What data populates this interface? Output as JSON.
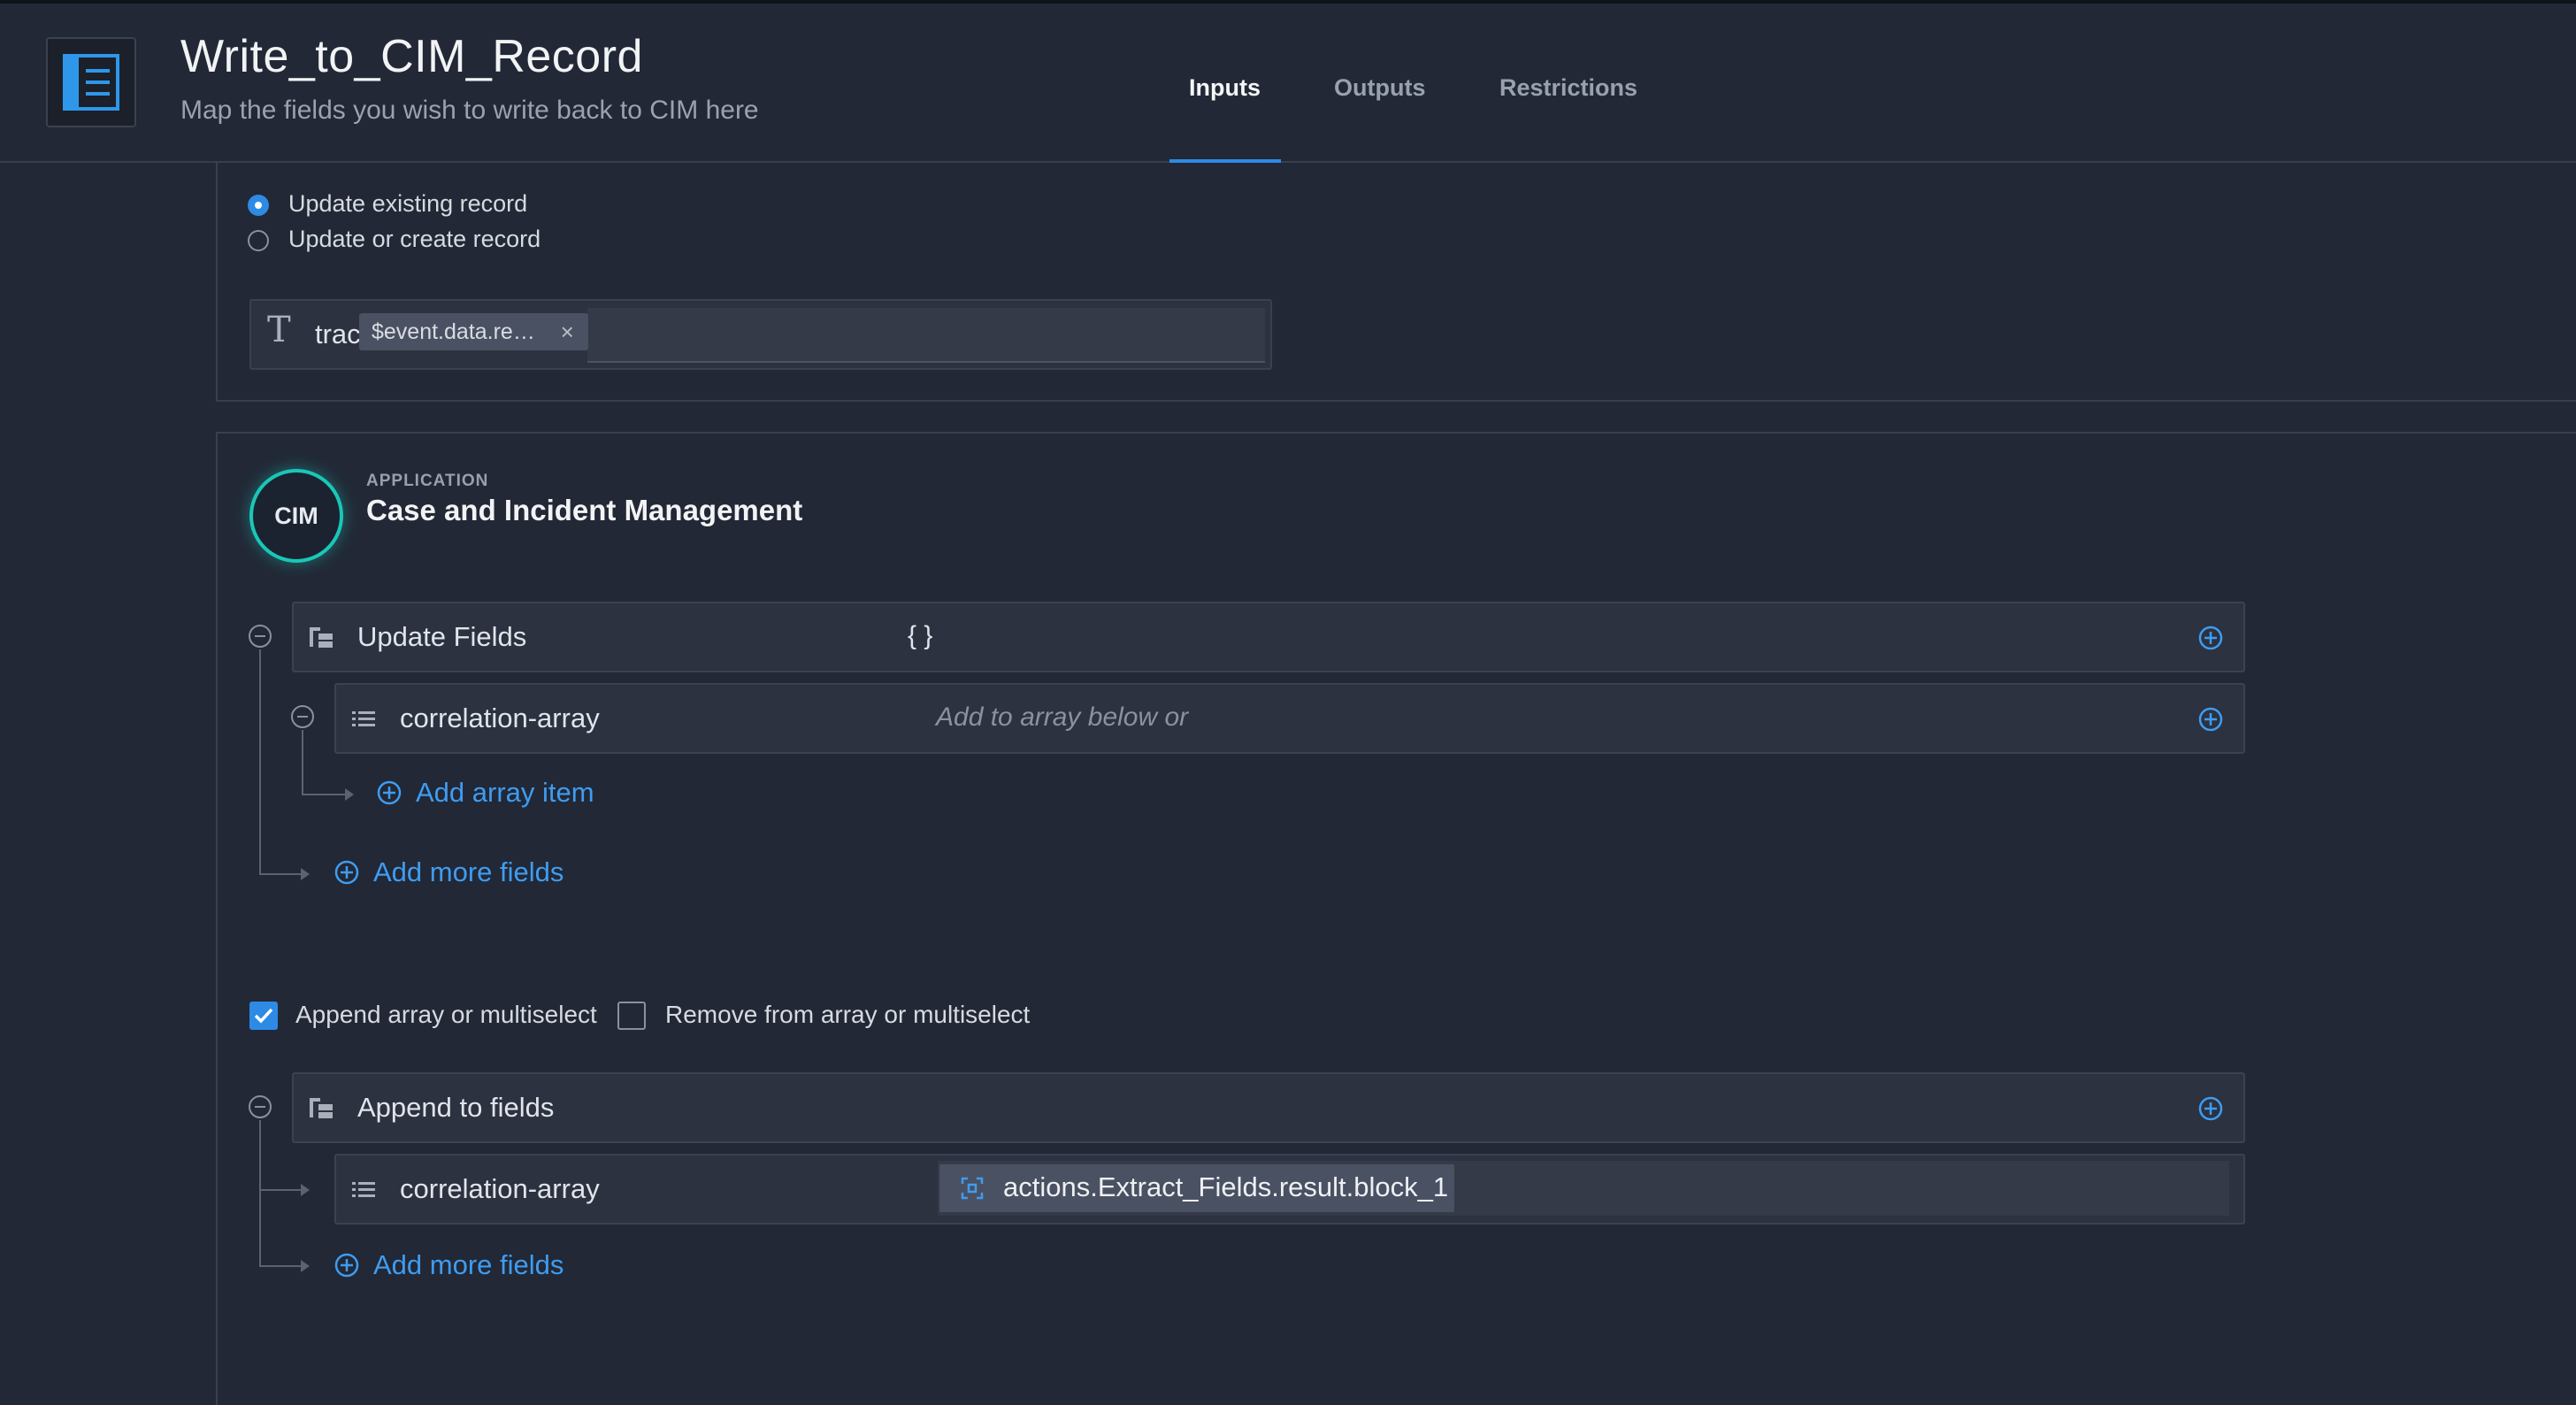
{
  "header": {
    "title": "Write_to_CIM_Record",
    "subtitle": "Map the fields you wish to write back to CIM here",
    "tabs": [
      {
        "label": "Inputs",
        "active": true
      },
      {
        "label": "Outputs",
        "active": false
      },
      {
        "label": "Restrictions",
        "active": false
      }
    ]
  },
  "record_mode": {
    "options": [
      {
        "label": "Update existing record",
        "selected": true
      },
      {
        "label": "Update or create record",
        "selected": false
      }
    ]
  },
  "tracking": {
    "type_icon": "T",
    "label": "tracking-id",
    "value_chip": "$event.data.re…",
    "chip_close": "×"
  },
  "application": {
    "badge": "CIM",
    "kicker": "APPLICATION",
    "name": "Case and Incident Management"
  },
  "update_fields": {
    "label": "Update Fields",
    "value": "{ }",
    "child": {
      "label": "correlation-array",
      "placeholder": "Add to array below or"
    },
    "add_array_item": "Add array item",
    "add_more_fields": "Add more fields"
  },
  "options": {
    "append": {
      "label": "Append array or multiselect",
      "checked": true
    },
    "remove": {
      "label": "Remove from array or multiselect",
      "checked": false
    }
  },
  "append_fields": {
    "label": "Append to fields",
    "child": {
      "label": "correlation-array",
      "value": "actions.Extract_Fields.result.block_1"
    },
    "add_more_fields": "Add more fields"
  },
  "colors": {
    "background": "#222836",
    "accent": "#2d8be6",
    "link": "#3f9cf0",
    "badge_ring": "#19c7b8"
  }
}
